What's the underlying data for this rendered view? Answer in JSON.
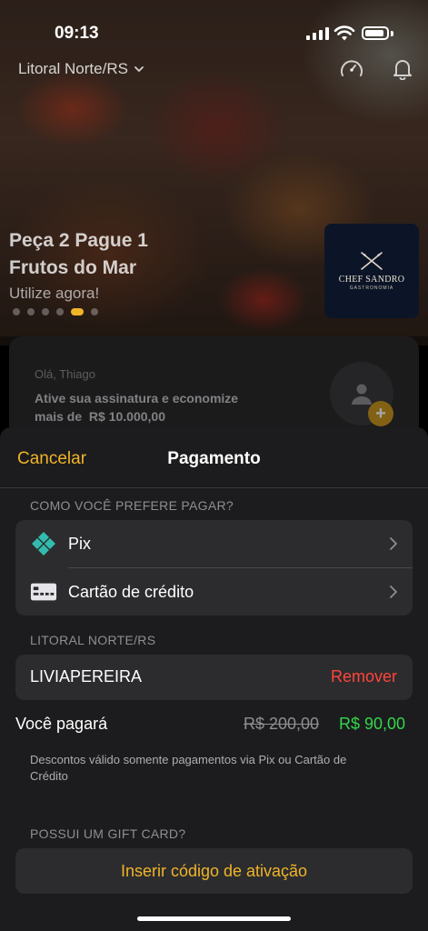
{
  "status_bar": {
    "time": "09:13"
  },
  "header": {
    "location": "Litoral Norte/RS",
    "icons": [
      "gauge-icon",
      "bell-icon"
    ]
  },
  "promo": {
    "title_line1": "Peça 2 Pague 1",
    "title_line2": "Frutos do Mar",
    "subtitle": "Utilize agora!",
    "active_slide": 5,
    "restaurant": {
      "name": "CHEF SANDRO",
      "tagline": "GASTRONOMIA"
    }
  },
  "profile_card": {
    "greeting": "Olá, Thiago",
    "message_line1": "Ative sua assinatura e economize",
    "message_line2": "mais de  R$ 10.000,00",
    "add_label": "+"
  },
  "sheet": {
    "cancel_label": "Cancelar",
    "title": "Pagamento",
    "payment_section_label": "COMO VOCÊ PREFERE PAGAR?",
    "payment_methods": [
      {
        "label": "Pix",
        "icon": "pix-icon"
      },
      {
        "label": "Cartão de crédito",
        "icon": "credit-card-icon"
      }
    ],
    "region_label": "LITORAL NORTE/RS",
    "coupon": {
      "code": "LIVIAPEREIRA",
      "remove_label": "Remover"
    },
    "summary": {
      "label": "Você pagará",
      "old_price": "R$ 200,00",
      "new_price": "R$ 90,00"
    },
    "disclaimer": "Descontos válido somente pagamentos via Pix ou Cartão de Crédito",
    "gift_card_label": "POSSUI UM GIFT CARD?",
    "activate_label": "Inserir código de ativação"
  },
  "colors": {
    "accent": "#f0b429",
    "danger": "#ff453a",
    "success": "#32d74b",
    "sheet_bg": "#1c1c1e",
    "row_bg": "#2c2c2e",
    "pix": "#32bcad"
  }
}
